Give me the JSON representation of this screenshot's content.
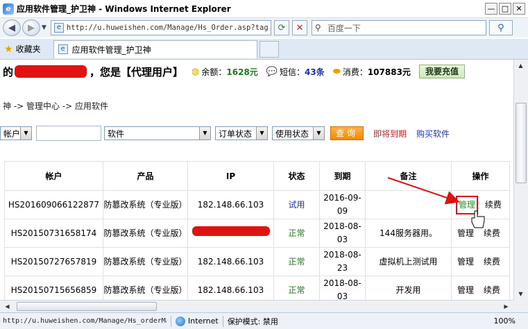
{
  "window": {
    "title": "应用软件管理_护卫神 - Windows Internet Explorer",
    "min_label": "—",
    "max_label": "□",
    "close_label": "✕"
  },
  "addressbar": {
    "url": "http://u.huweishen.com/Manage/Hs_Order.asp?tag",
    "search_placeholder": "百度一下"
  },
  "favorites": {
    "label": "收藏夹",
    "tab_title": "应用软件管理_护卫神"
  },
  "userbar": {
    "prefix": "的",
    "greeting": "，您是【代理用户】",
    "balance_label": "余额：",
    "balance_value": "1628元",
    "sms_label": "短信：",
    "sms_value": "43条",
    "spend_label": "消费：",
    "spend_value": "107883元",
    "recharge_button": "我要充值"
  },
  "breadcrumb": "神 -> 管理中心 -> 应用软件",
  "filters": {
    "account_select": "帐户",
    "product_select": "软件",
    "order_status_select": "订单状态",
    "use_status_select": "使用状态",
    "query_button": "查询",
    "expiring_link": "即将到期",
    "buy_link": "购买软件"
  },
  "table": {
    "headers": [
      "帐户",
      "产品",
      "IP",
      "状态",
      "到期",
      "备注",
      "操作"
    ],
    "rows": [
      {
        "account": "HS201609066122877",
        "product": "防篡改系统（专业版）",
        "ip": "182.148.66.103",
        "status": "试用",
        "expiry_1": "2016-09-",
        "expiry_2": "09",
        "note": "",
        "manage": "管理",
        "renew": "续费"
      },
      {
        "account": "HS20150731658174",
        "product": "防篡改系统（专业版）",
        "ip": "",
        "status": "正常",
        "expiry_1": "2018-08-",
        "expiry_2": "03",
        "note": "144服务器用。",
        "manage": "管理",
        "renew": "续费"
      },
      {
        "account": "HS20150727657819",
        "product": "防篡改系统（专业版）",
        "ip": "182.148.66.103",
        "status": "正常",
        "expiry_1": "2018-08-",
        "expiry_2": "23",
        "note": "虚拟机上测试用",
        "manage": "管理",
        "renew": "续费"
      },
      {
        "account": "HS20150715656859",
        "product": "防篡改系统（专业版）",
        "ip": "182.148.66.103",
        "status": "正常",
        "expiry_1": "2018-08-",
        "expiry_2": "03",
        "note": "开发用",
        "manage": "管理",
        "renew": "续费"
      }
    ]
  },
  "statusbar": {
    "url": "http://u.huweishen.com/Manage/Hs_orderMa",
    "zone": "Internet",
    "protected_mode": "保护模式: 禁用",
    "zoom": "100%"
  },
  "colors": {
    "status_trial": "#1b34a8",
    "status_normal": "#1c7a1c",
    "highlight": "#e01010",
    "query_button": "#f08a00"
  },
  "icons": [
    "ie-logo-icon",
    "back-icon",
    "forward-icon",
    "page-icon",
    "refresh-icon",
    "stop-icon",
    "search-icon",
    "favorites-star-icon",
    "coins-icon",
    "speech-bubble-icon",
    "gold-ingot-icon",
    "globe-icon",
    "hand-cursor-icon"
  ]
}
